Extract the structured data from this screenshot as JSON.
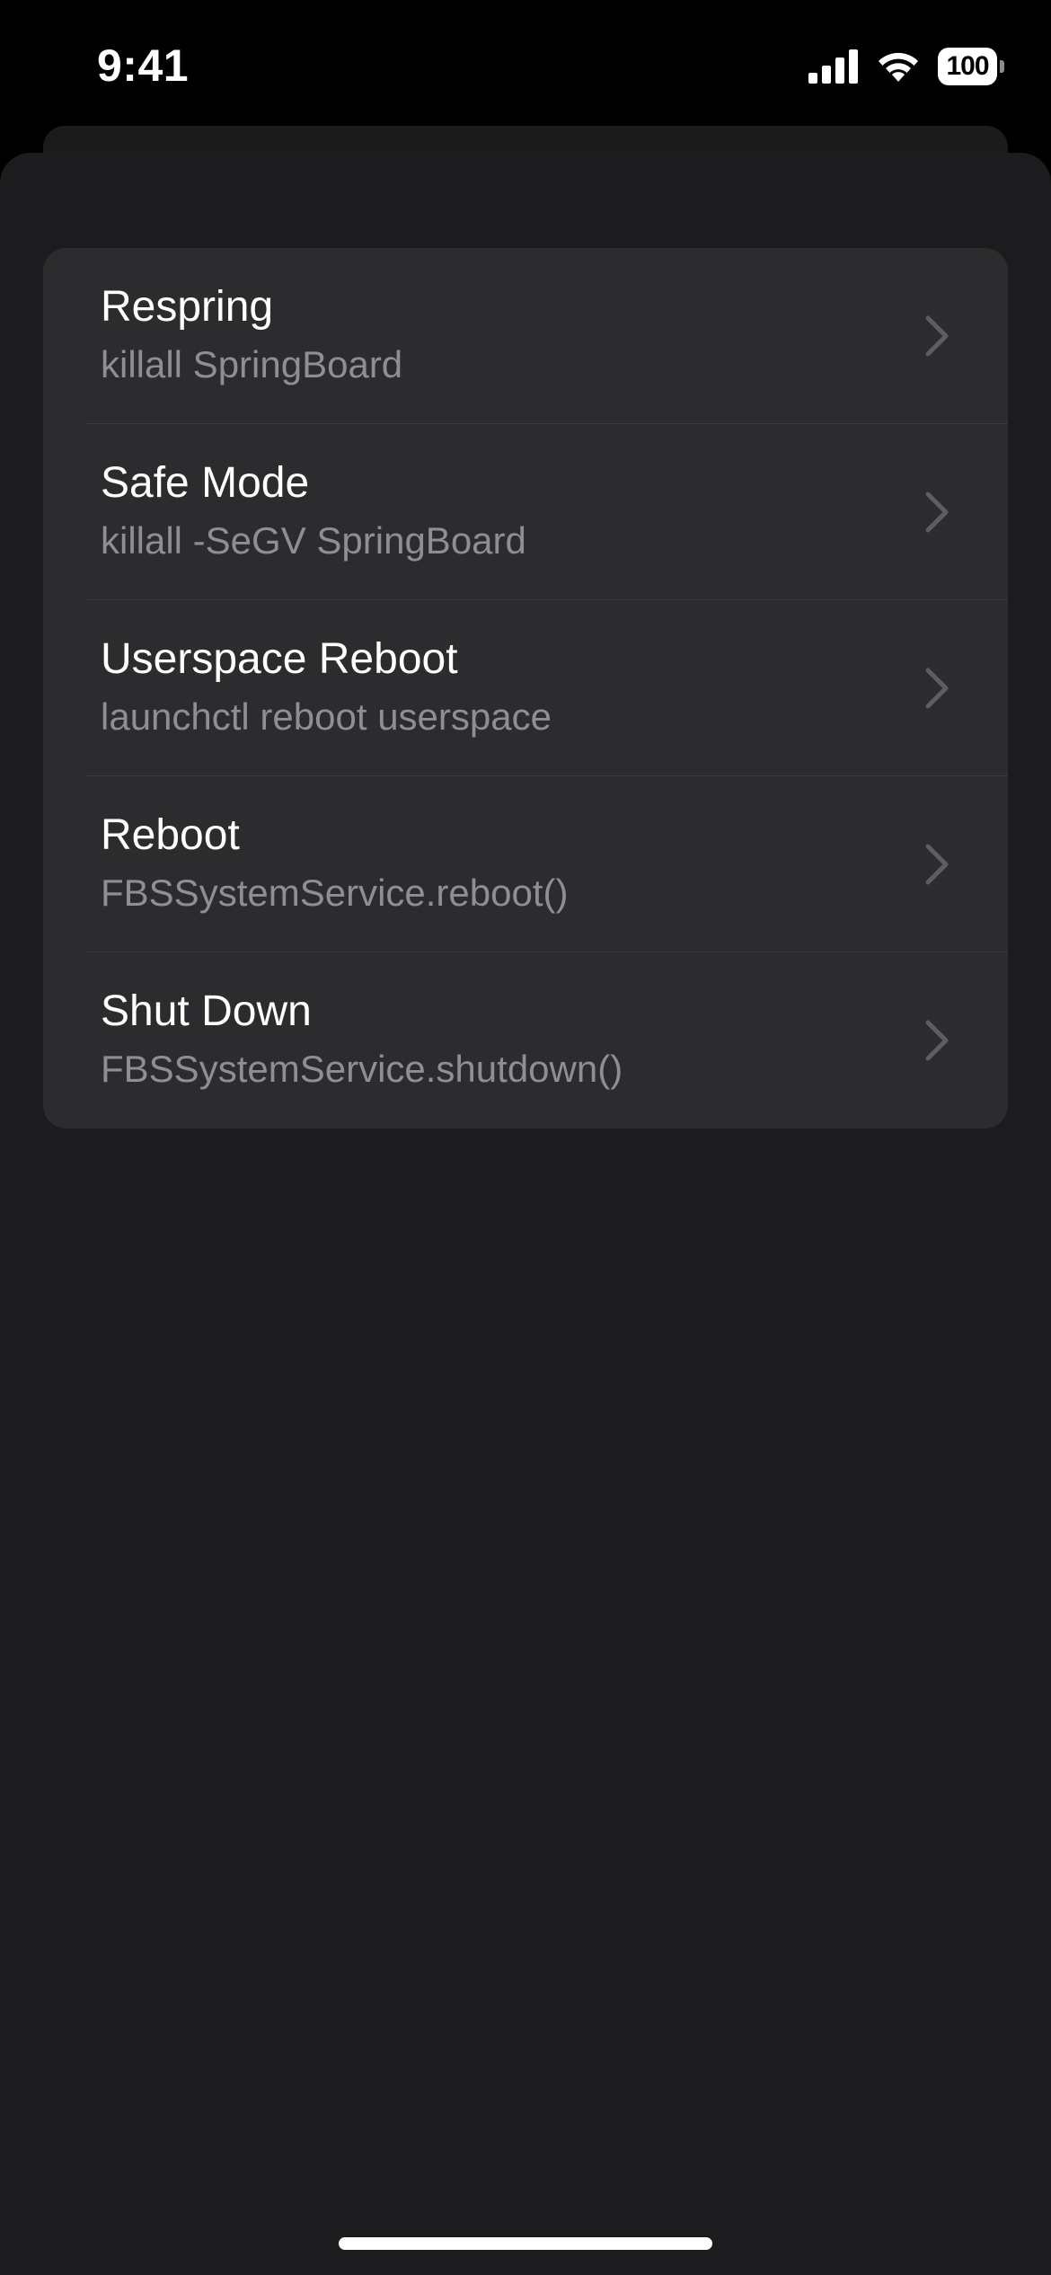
{
  "status_bar": {
    "time": "9:41",
    "battery_level": "100",
    "icons": [
      "signal-icon",
      "wifi-icon",
      "battery-icon"
    ]
  },
  "menu": {
    "items": [
      {
        "title": "Respring",
        "subtitle": "killall SpringBoard",
        "icon": "chevron-right-icon"
      },
      {
        "title": "Safe Mode",
        "subtitle": "killall -SeGV SpringBoard",
        "icon": "chevron-right-icon"
      },
      {
        "title": "Userspace Reboot",
        "subtitle": "launchctl reboot userspace",
        "icon": "chevron-right-icon"
      },
      {
        "title": "Reboot",
        "subtitle": "FBSSystemService.reboot()",
        "icon": "chevron-right-icon"
      },
      {
        "title": "Shut Down",
        "subtitle": "FBSSystemService.shutdown()",
        "icon": "chevron-right-icon"
      }
    ]
  },
  "colors": {
    "background": "#000000",
    "sheet": "#1c1c1e",
    "cell": "#2c2c2e",
    "separator": "#3a3a3c",
    "title_text": "#ffffff",
    "subtitle_text": "#8e8e93",
    "chevron": "#5e5e62"
  }
}
